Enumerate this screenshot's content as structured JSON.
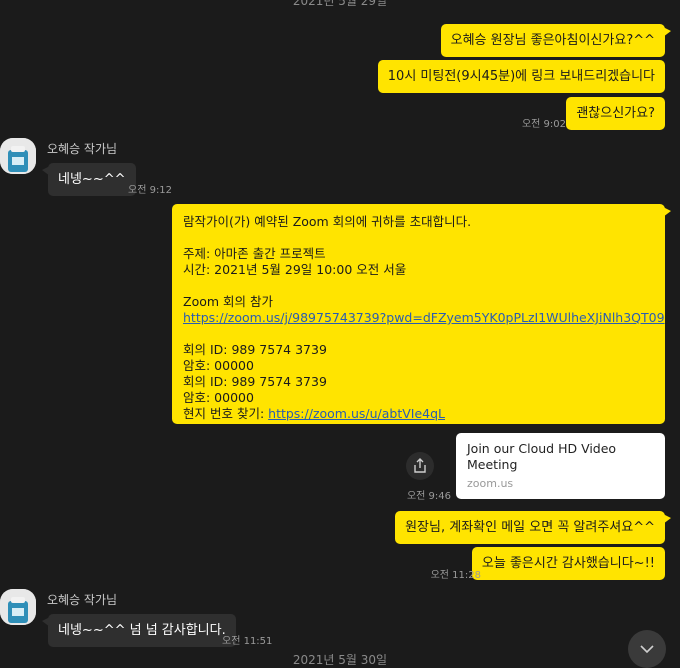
{
  "dates": {
    "top": "2021년 5월 29일",
    "bottom": "2021년 5월 30일"
  },
  "contact": {
    "name": "오혜승 작가님"
  },
  "messages": {
    "m1": "오혜승 원장님 좋은아침이신가요?^^",
    "m2": "10시 미팅전(9시45분)에 링크 보내드리겠습니다",
    "m3": "괜찮으신가요?",
    "t3": "오전 9:02",
    "r1": "네넹~~^^",
    "tr1": "오전 9:12",
    "invite": {
      "l1": "람작가이(가) 예약된 Zoom 회의에 귀하를 초대합니다.",
      "l2": "주제: 아마존 출간 프로젝트",
      "l3": "시간: 2021년 5월 29일  10:00 오전 서울",
      "l4": "Zoom 회의 참가",
      "l5": "https://zoom.us/j/98975743739?pwd=dFZyem5YK0pPLzI1WUlheXJiNlh3QT09",
      "l6": "회의 ID: 989 7574 3739",
      "l7": "암호: 00000",
      "l8": "회의 ID: 989 7574 3739",
      "l9": "암호: 00000",
      "l10_label": "현지 번호 찾기: ",
      "l10_link": "https://zoom.us/u/abtVIe4qL"
    },
    "card": {
      "title": "Join our Cloud HD Video Meeting",
      "domain": "zoom.us"
    },
    "tcard": "오전 9:46",
    "m4": "원장님, 계좌확인 메일 오면 꼭 알려주셔요^^",
    "m5": "오늘 좋은시간 감사했습니다~!!",
    "t5": "오전 11:28",
    "r2": "네넹~~^^ 넘 넘 감사합니다.",
    "tr2": "오전 11:51"
  },
  "icons": {
    "share": "share-icon",
    "scroll": "chevron-down-icon",
    "avatar": "avatar"
  },
  "colors": {
    "my_bubble": "#ffe400",
    "other_bubble": "#2f2f2f",
    "background": "#1b1b1b"
  }
}
